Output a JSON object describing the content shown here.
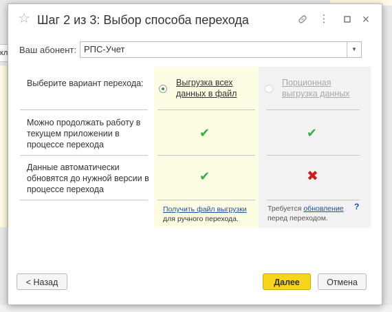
{
  "background": {
    "field_fragment": "кл"
  },
  "dialog": {
    "title": "Шаг 2 из 3: Выбор способа перехода",
    "icons": [
      "star-icon",
      "link-icon",
      "more-icon",
      "maximize-icon",
      "close-icon"
    ]
  },
  "subscriber": {
    "label": "Ваш абонент:",
    "value": "РПС-Учет"
  },
  "comparison": {
    "rows": [
      {
        "label": "Выберите вариант перехода:"
      },
      {
        "label": "Можно продолжать работу в текущем приложении в процессе перехода",
        "option_a": "yes",
        "option_b": "yes"
      },
      {
        "label": "Данные автоматически обновятся до нужной версии в процессе перехода",
        "option_a": "yes",
        "option_b": "no"
      }
    ],
    "option_a": {
      "label": "Выгрузка всех данных в файл",
      "selected": true,
      "footer_link": "Получить файл выгрузки",
      "footer_text": "для ручного перехода."
    },
    "option_b": {
      "label": "Порционная выгрузка данных",
      "selected": false,
      "enabled": false,
      "footer_prefix": "Требуется ",
      "footer_link": "обновление",
      "footer_text": "перед переходом.",
      "help": "?"
    }
  },
  "buttons": {
    "back": "< Назад",
    "next": "Далее",
    "cancel": "Отмена"
  },
  "colors": {
    "accent_button": "#f7d51c",
    "check": "#3dab48",
    "cross": "#d11a1a",
    "column_a_bg": "#fdfde4",
    "column_b_bg": "#f2f2f2"
  }
}
